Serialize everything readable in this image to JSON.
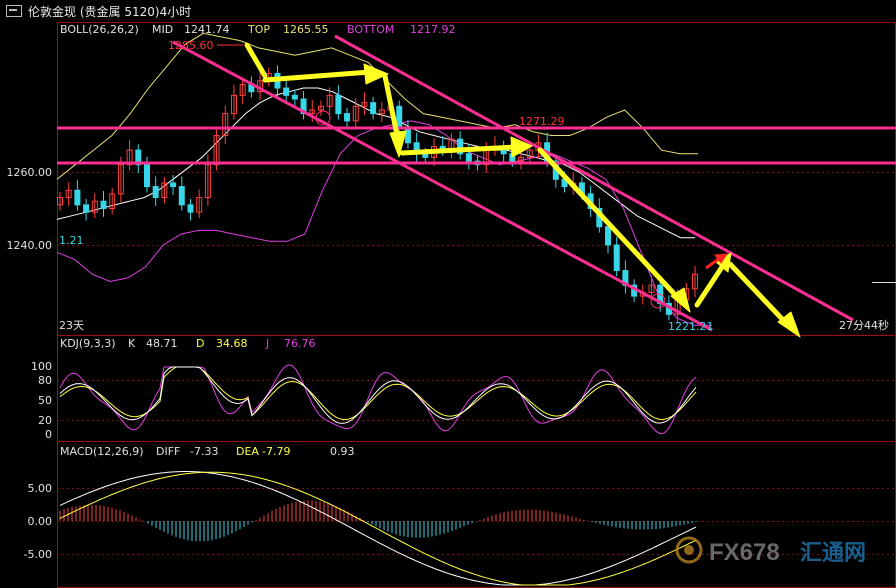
{
  "window": {
    "title_left": "伦敦金现",
    "title_mid": "(贵金属",
    "title_right": "5120)4小时"
  },
  "colors": {
    "up": "#ff4040",
    "down": "#37d6e8",
    "boll_mid": "#ffffff",
    "boll_top": "#e8e070",
    "boll_bottom": "#e040e0",
    "channel": "#ff2e92",
    "arrow": "#ffff22",
    "k": "#ffffff",
    "d": "#ffff44",
    "j": "#e040e0",
    "grid": "#8a1010"
  },
  "main_panel": {
    "indicator": "BOLL(26,26,2)",
    "mid_label": "MID",
    "mid_value": "1241.74",
    "top_label": "TOP",
    "top_value": "1265.55",
    "bottom_label": "BOTTOM",
    "bottom_value": "1217.92",
    "y_ticks": [
      "1260.00",
      "1240.00"
    ],
    "left_edge_label": "1.21",
    "days_label": "23天",
    "countdown": "27分44秒",
    "high_annotation": "1285.60",
    "mid_annotation": "1271.29",
    "low_annotation": "1221.21"
  },
  "kdj_panel": {
    "indicator": "KDJ(9,3,3)",
    "k_label": "K",
    "k_value": "48.71",
    "d_label": "D",
    "d_value": "34.68",
    "j_label": "J",
    "j_value": "76.76",
    "y_ticks": [
      "100",
      "80",
      "50",
      "20",
      "0"
    ]
  },
  "macd_panel": {
    "indicator": "MACD(12,26,9)",
    "diff_label": "DIFF",
    "diff_value": "-7.33",
    "dea_label": "DEA",
    "dea_value": "-7.79",
    "macd_value": "0.93",
    "y_ticks": [
      "5.00",
      "0.00",
      "-5.00"
    ]
  },
  "watermark": {
    "brand": "FX678",
    "cn": "汇通网"
  },
  "chart_data": {
    "type": "candlestick",
    "close": [
      1253,
      1255,
      1251,
      1249,
      1252,
      1250,
      1254,
      1262,
      1266,
      1262,
      1256,
      1253,
      1257,
      1256,
      1251,
      1249,
      1253,
      1262,
      1270,
      1276,
      1281,
      1284,
      1282,
      1285,
      1287,
      1283,
      1281,
      1280,
      1276,
      1277,
      1278,
      1281,
      1276,
      1274,
      1278,
      1279,
      1276,
      1277,
      1278,
      1272,
      1268,
      1265,
      1264,
      1267,
      1266,
      1269,
      1265,
      1263,
      1262,
      1266,
      1267,
      1265,
      1263,
      1264,
      1266,
      1268,
      1263,
      1258,
      1256,
      1257,
      1254,
      1250,
      1245,
      1240,
      1233,
      1229,
      1226,
      1227,
      1229,
      1224,
      1221,
      1225,
      1228,
      1232
    ],
    "boll": {
      "mid": [
        1247,
        1248,
        1249,
        1250,
        1251,
        1252,
        1253,
        1255,
        1258,
        1261,
        1264,
        1268,
        1272,
        1276,
        1279,
        1281,
        1282,
        1283,
        1283,
        1282,
        1280,
        1278,
        1276,
        1275,
        1273,
        1271,
        1270,
        1269,
        1268,
        1267,
        1266,
        1266,
        1265,
        1264,
        1263,
        1262,
        1260,
        1257,
        1254,
        1251,
        1248,
        1246,
        1244,
        1242,
        1242
      ],
      "top": [
        1258,
        1262,
        1266,
        1270,
        1276,
        1283,
        1289,
        1295,
        1298,
        1297,
        1296,
        1294,
        1293,
        1292,
        1293,
        1294,
        1292,
        1290,
        1285,
        1280,
        1276,
        1275,
        1274,
        1273,
        1272,
        1273,
        1271,
        1270,
        1270,
        1272,
        1275,
        1277,
        1272,
        1266,
        1265,
        1265
      ],
      "bottom": [
        1238,
        1236,
        1232,
        1230,
        1231,
        1234,
        1240,
        1243,
        1244,
        1244,
        1243,
        1242,
        1241,
        1241,
        1243,
        1255,
        1265,
        1270,
        1272,
        1273,
        1274,
        1273,
        1270,
        1266,
        1264,
        1262,
        1263,
        1264,
        1265,
        1263,
        1261,
        1258,
        1250,
        1238,
        1226,
        1220,
        1218,
        1218
      ]
    },
    "kdj_range": [
      0,
      100
    ],
    "kdj_last": {
      "K": 48.71,
      "D": 34.68,
      "J": 76.76
    },
    "macd_range": [
      -5,
      5
    ],
    "macd_last": {
      "DIFF": -7.33,
      "DEA": -7.79,
      "MACD": 0.93
    }
  }
}
